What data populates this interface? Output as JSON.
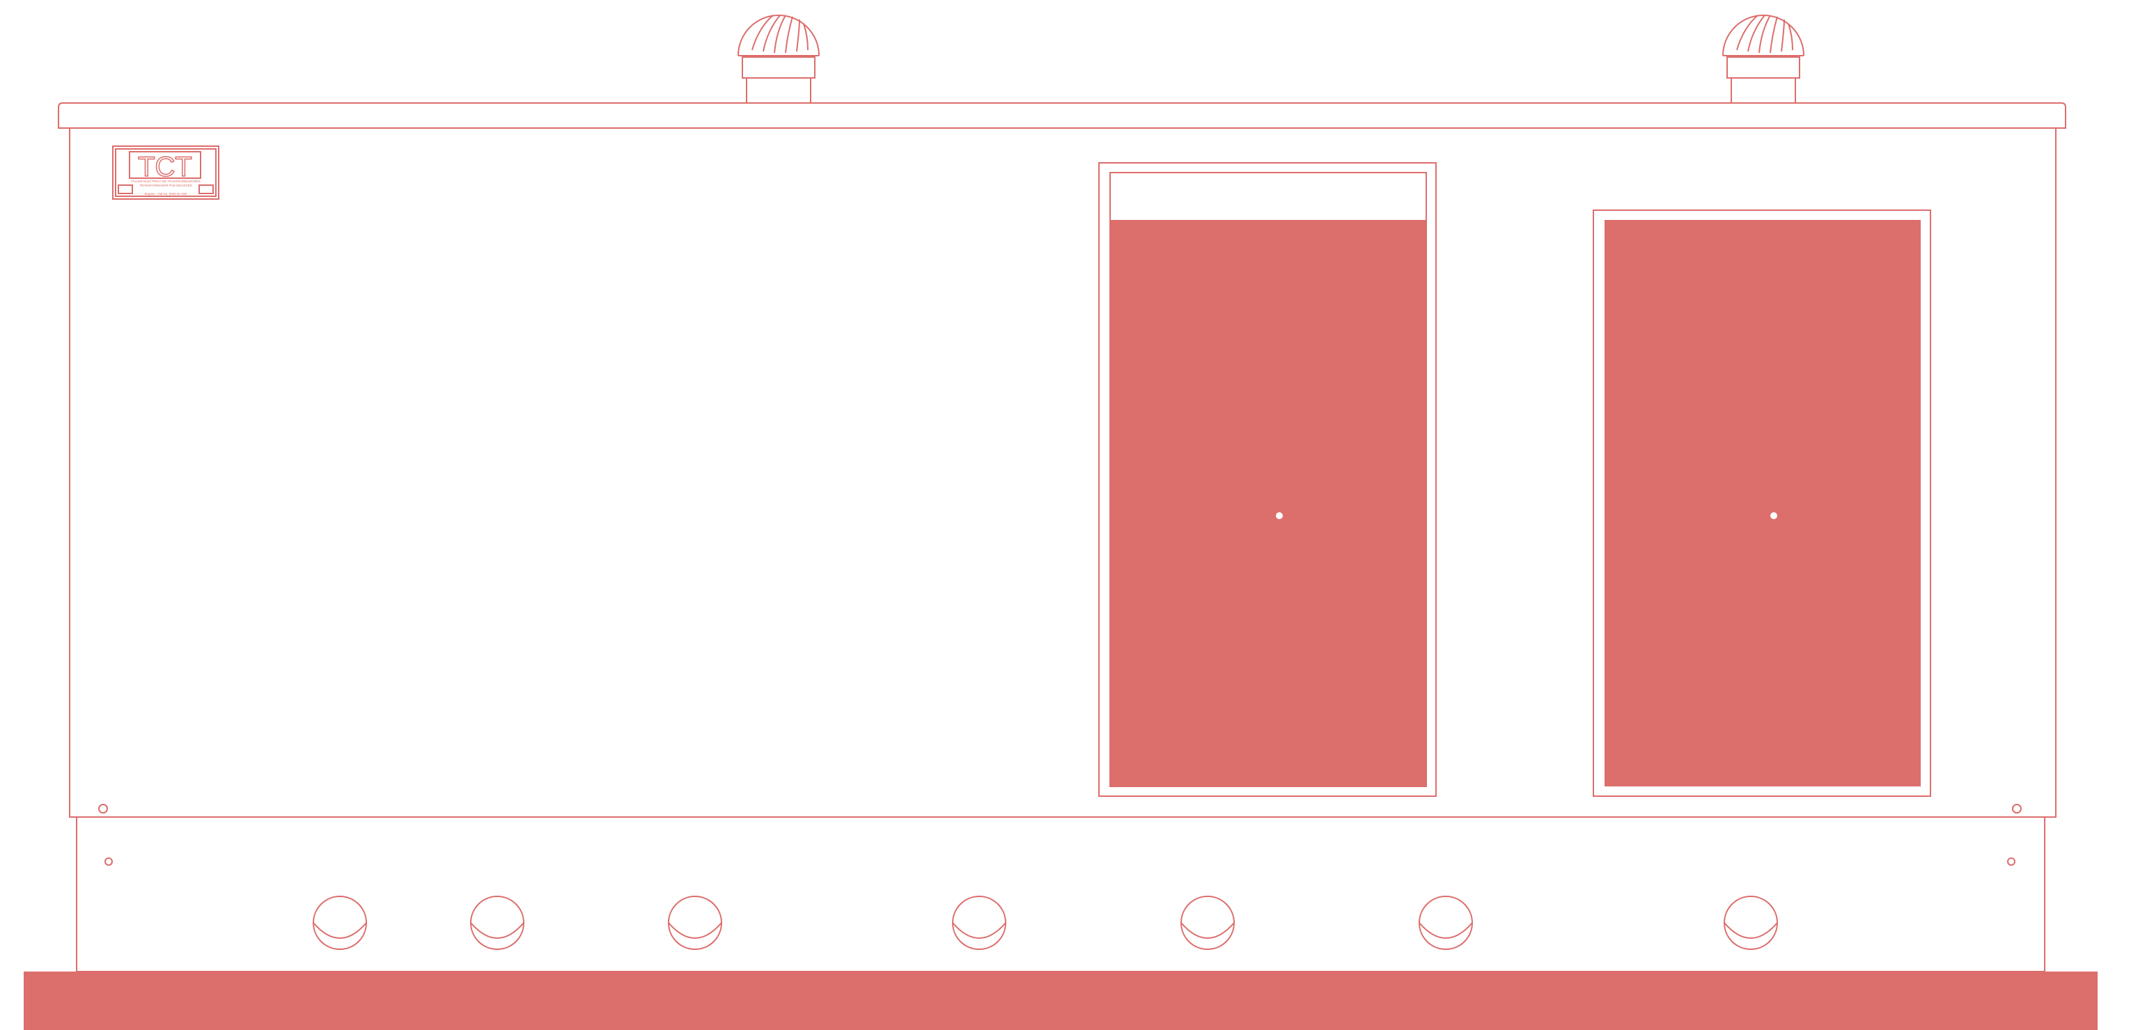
{
  "colors": {
    "line": "#dc6e6c",
    "fill": "#dc6e6c",
    "background": "#ffffff",
    "knob": "#ffffff"
  },
  "nameplate": {
    "logo_text": "TCT",
    "caption_lines": [
      "TALLER ELECTRICO DE TRANSFORMADORES",
      "TRANSFORMADOR PAD MOUNTED",
      "",
      "Bogota - Vial No. 0000 Dc-000"
    ]
  },
  "icons": {
    "vent": "turbine-vent-icon",
    "bushing": "bushing-icon",
    "bolt": "bolt-icon"
  },
  "components": {
    "roof_vents": 2,
    "access_doors": 2,
    "bushings": 7
  }
}
